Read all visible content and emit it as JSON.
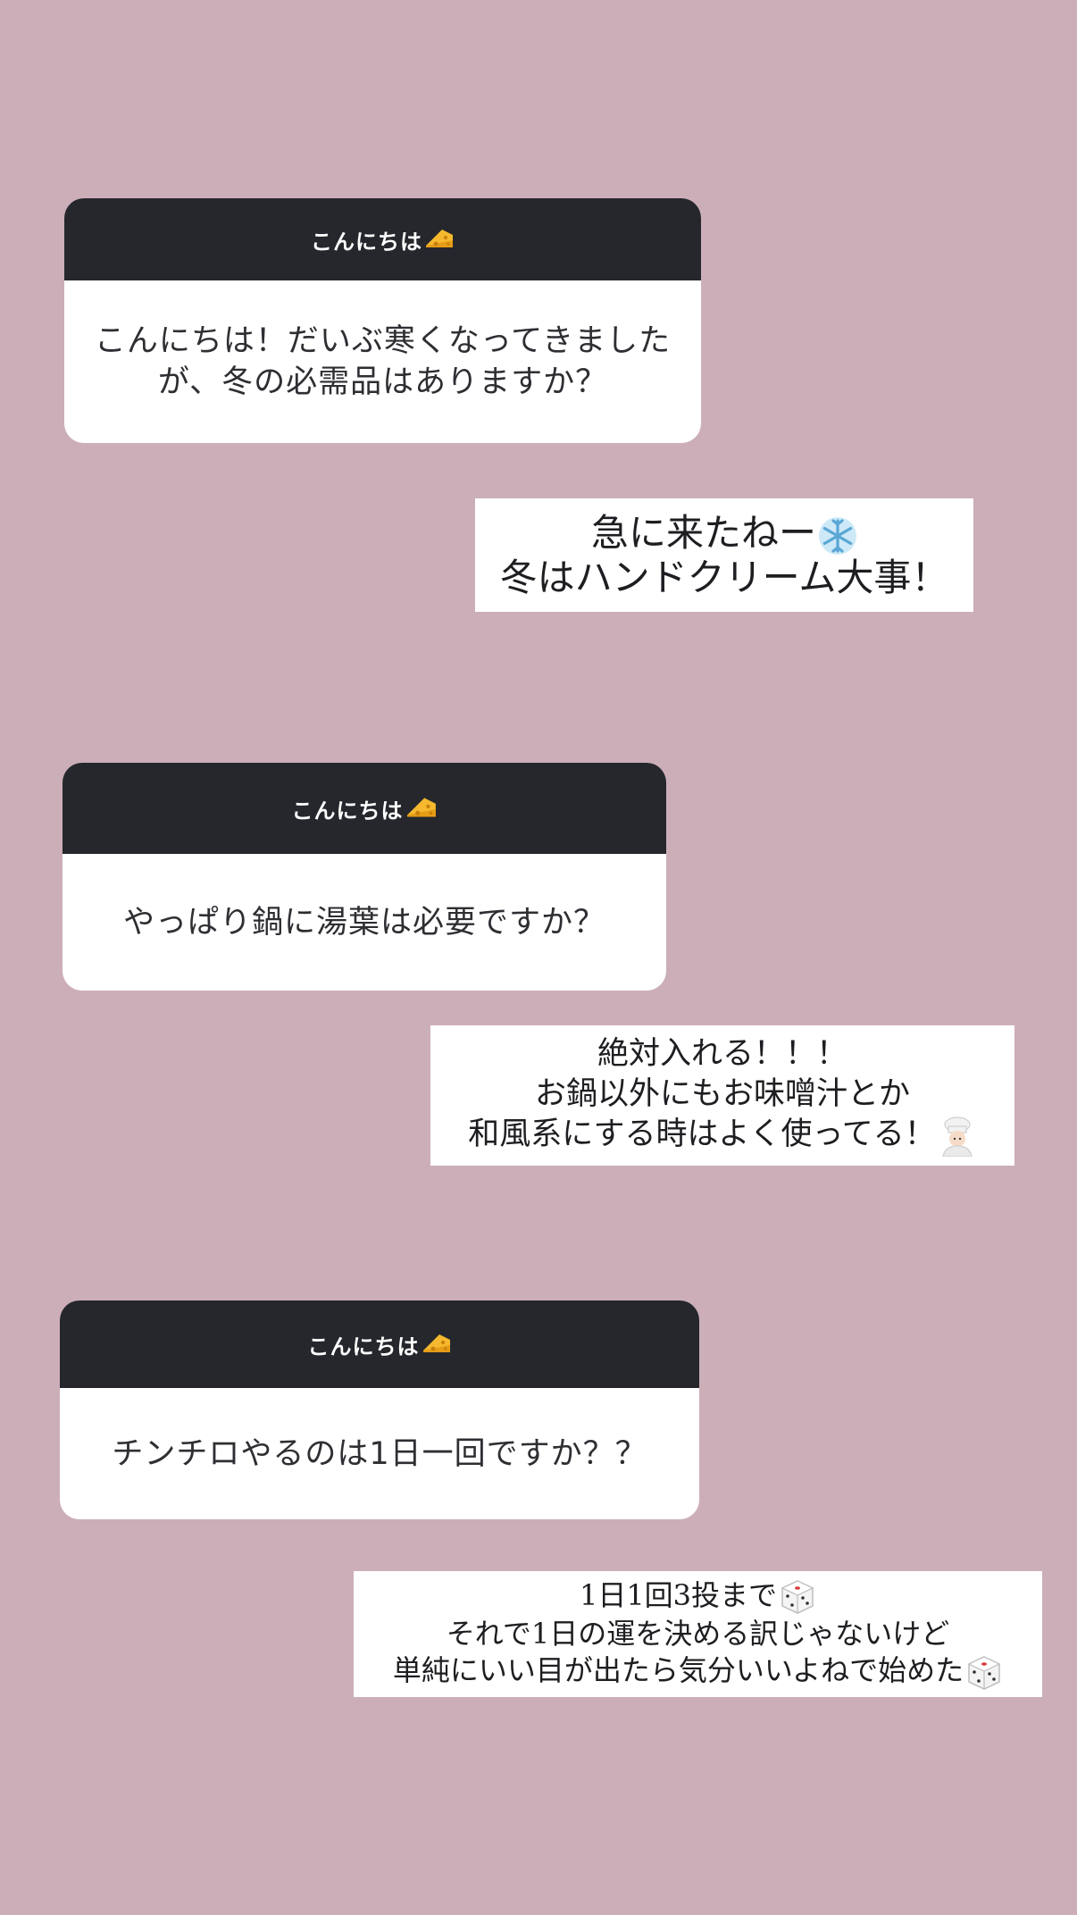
{
  "colors": {
    "background": "#ccaeb8",
    "card_header": "#25272c",
    "card_body": "#ffffff",
    "card_text": "#2e2e33"
  },
  "stories": [
    {
      "question": {
        "header": "こんにちは",
        "header_icon": "cheese-icon",
        "lines": [
          "こんにちは！だいぶ寒くなってきました",
          "が、冬の必需品はありますか？"
        ]
      },
      "answer": {
        "lines": [
          "急に来たねー",
          "冬はハンドクリーム大事！"
        ],
        "icons": [
          "snowflake-icon"
        ]
      }
    },
    {
      "question": {
        "header": "こんにちは",
        "header_icon": "cheese-icon",
        "lines": [
          "やっぱり鍋に湯葉は必要ですか？"
        ]
      },
      "answer": {
        "lines": [
          "絶対入れる！！！",
          "お鍋以外にもお味噌汁とか",
          "和風系にする時はよく使ってる！"
        ],
        "icons": [
          "cook-icon"
        ]
      }
    },
    {
      "question": {
        "header": "こんにちは",
        "header_icon": "cheese-icon",
        "lines": [
          "チンチロやるのは1日一回ですか？？"
        ]
      },
      "answer": {
        "lines": [
          "1日1回3投まで",
          "それで1日の運を決める訳じゃないけど",
          "単純にいい目が出たら気分いいよねで始めた"
        ],
        "icons": [
          "dice-icon",
          "dice-icon"
        ]
      }
    }
  ]
}
